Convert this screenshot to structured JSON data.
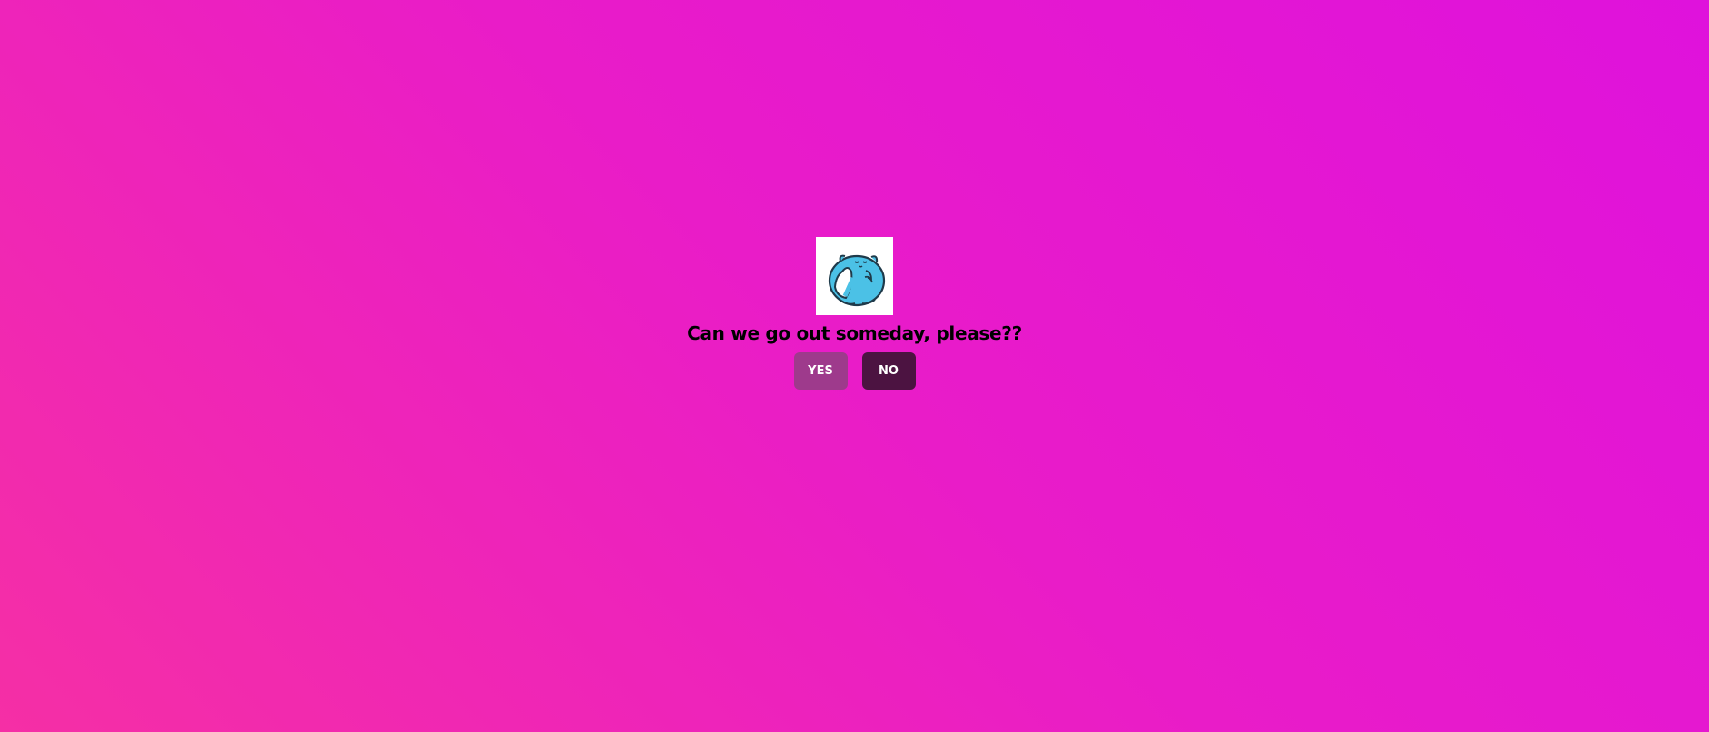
{
  "page": {
    "background_colors": [
      "#f52fa5",
      "#e91cc8",
      "#df12dc"
    ]
  },
  "mascot": {
    "icon": "blue-cat-hiding-face-icon",
    "body_color": "#4bc1e6",
    "outline_color": "#1f3a4a"
  },
  "question": {
    "text": "Can we go out someday, please??"
  },
  "buttons": {
    "yes_label": "YES",
    "yes_color": "#9e3a8c",
    "no_label": "NO",
    "no_color": "#4c1341"
  }
}
